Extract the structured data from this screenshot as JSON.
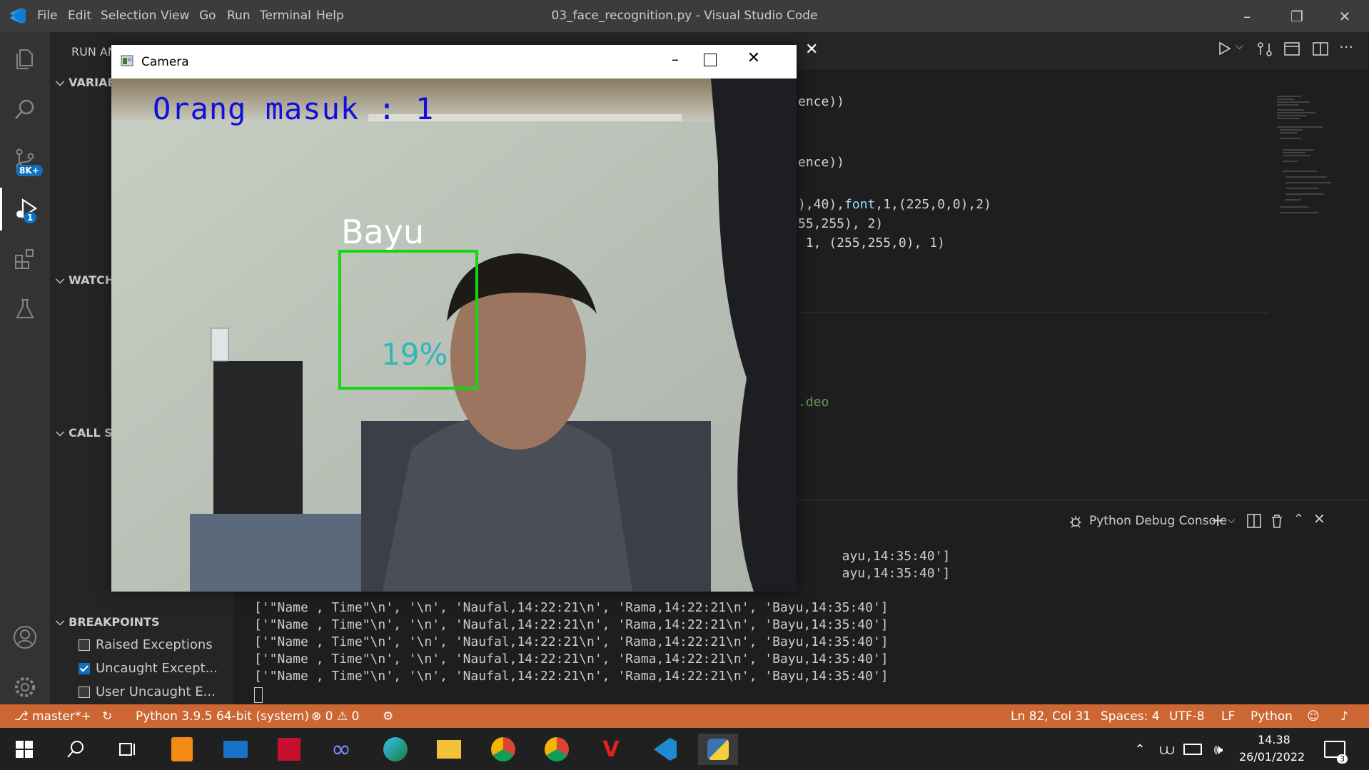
{
  "window_title": "03_face_recognition.py - Visual Studio Code",
  "menu": [
    "File",
    "Edit",
    "Selection",
    "View",
    "Go",
    "Run",
    "Terminal",
    "Help"
  ],
  "activity_badges": {
    "source_control": "8K+",
    "debug": "1"
  },
  "sidebar": {
    "header": "RUN AN",
    "variables": "VARIAE",
    "watch": "WATCH",
    "callstack": "CALL S",
    "breakpoints": {
      "title": "BREAKPOINTS",
      "items": [
        {
          "label": "Raised Exceptions",
          "checked": false
        },
        {
          "label": "Uncaught Except...",
          "checked": true
        },
        {
          "label": "User Uncaught E...",
          "checked": false
        }
      ]
    }
  },
  "editor": {
    "lines": [
      {
        "text": "ence))"
      },
      {
        "text": "ence))"
      },
      {
        "pre": "),40),",
        "kw": "font",
        "post": ",1,(225,0,0),2)"
      },
      {
        "text": "55,255), 2)"
      },
      {
        "text": " 1, (255,255,0), 1)"
      },
      {
        "text": ".deo"
      }
    ]
  },
  "panel": {
    "title": "Python Debug Console",
    "lines": [
      "                                                                            ayu,14:35:40']",
      "                                                                            ayu,14:35:40']",
      "['\"Name , Time\"\\n', '\\n', 'Naufal,14:22:21\\n', 'Rama,14:22:21\\n', 'Bayu,14:35:40']",
      "['\"Name , Time\"\\n', '\\n', 'Naufal,14:22:21\\n', 'Rama,14:22:21\\n', 'Bayu,14:35:40']",
      "['\"Name , Time\"\\n', '\\n', 'Naufal,14:22:21\\n', 'Rama,14:22:21\\n', 'Bayu,14:35:40']",
      "['\"Name , Time\"\\n', '\\n', 'Naufal,14:22:21\\n', 'Rama,14:22:21\\n', 'Bayu,14:35:40']",
      "['\"Name , Time\"\\n', '\\n', 'Naufal,14:22:21\\n', 'Rama,14:22:21\\n', 'Bayu,14:35:40']"
    ]
  },
  "camera": {
    "title": "Camera",
    "overlay_count": "Orang masuk : 1",
    "face_name": "Bayu",
    "confidence": "19%"
  },
  "status": {
    "branch": "master*+",
    "interpreter": "Python 3.9.5 64-bit (system)",
    "errors": "0",
    "warnings": "0",
    "position": "Ln 82, Col 31",
    "spaces": "Spaces: 4",
    "encoding": "UTF-8",
    "eol": "LF",
    "language": "Python"
  },
  "taskbar": {
    "time": "14.38",
    "date": "26/01/2022",
    "notifications": "3"
  },
  "colors": {
    "status_bar": "#cc6633",
    "activity_bar": "#333333",
    "sidebar": "#252526",
    "editor": "#1e1e1e",
    "accent": "#0e70c0"
  }
}
